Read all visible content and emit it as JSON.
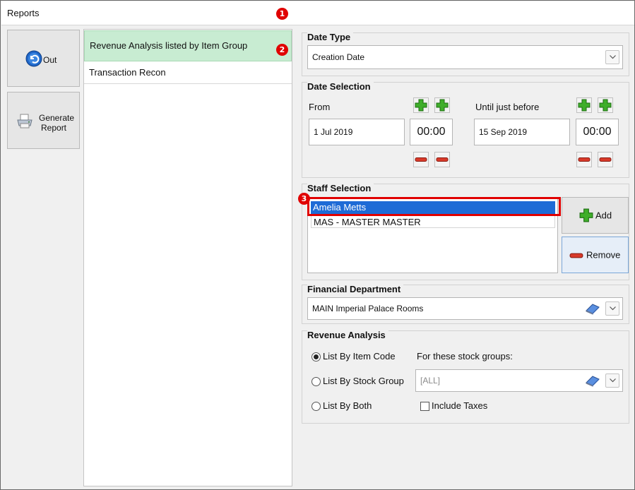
{
  "window": {
    "title": "Reports"
  },
  "markers": {
    "m1": "1",
    "m2": "2",
    "m3": "3"
  },
  "sidebar": {
    "out_label": "Out",
    "generate_label_line1": "Generate",
    "generate_label_line2": "Report"
  },
  "reports": {
    "items": [
      {
        "label": "Revenue Analysis listed by Item Group",
        "selected": true
      },
      {
        "label": "Transaction Recon",
        "selected": false
      }
    ]
  },
  "date_type": {
    "title": "Date Type",
    "value": "Creation Date"
  },
  "date_selection": {
    "title": "Date Selection",
    "from_label": "From",
    "from_date": "1 Jul 2019",
    "from_time": "00:00",
    "until_label": "Until just before",
    "until_date": "15 Sep 2019",
    "until_time": "00:00"
  },
  "staff_selection": {
    "title": "Staff Selection",
    "staff": [
      {
        "name": "Amelia Metts",
        "selected": true
      },
      {
        "name": "MAS - MASTER MASTER",
        "selected": false
      }
    ],
    "add_label": "Add",
    "remove_label": "Remove"
  },
  "financial_department": {
    "title": "Financial Department",
    "value": "MAIN Imperial Palace Rooms"
  },
  "revenue_analysis": {
    "title": "Revenue Analysis",
    "options": [
      {
        "label": "List By Item Code",
        "checked": true
      },
      {
        "label": "List By Stock Group",
        "checked": false
      },
      {
        "label": "List By Both",
        "checked": false
      }
    ],
    "stock_groups_label": "For these stock groups:",
    "stock_groups_value": "[ALL]",
    "include_taxes_label": "Include Taxes",
    "include_taxes_checked": false
  },
  "colors": {
    "selected_report_bg": "#c8ecd2",
    "selected_staff_bg": "#1e6bd6",
    "marker_red": "#e00000",
    "plus_green": "#3fae2a",
    "minus_red": "#d83a2a"
  },
  "icons": {
    "out": "back-arrow-circle-icon",
    "generate": "printer-icon",
    "add": "green-plus-icon",
    "remove": "red-minus-icon",
    "clear": "eraser-icon",
    "dropdown": "chevron-down-icon"
  }
}
